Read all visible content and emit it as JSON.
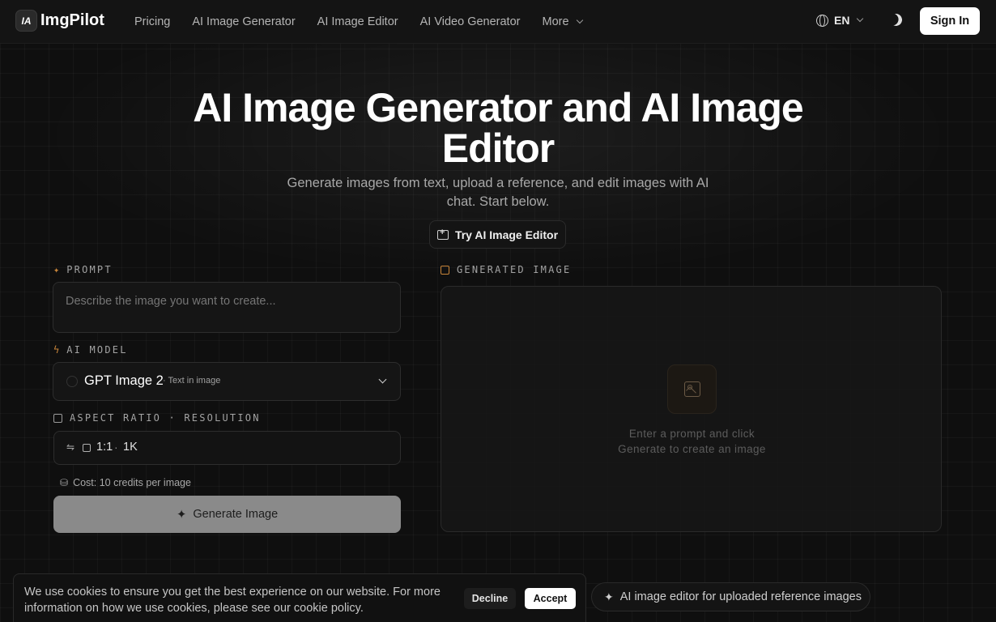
{
  "nav": {
    "logo_mark": "IA",
    "logo_text": "ImgPilot",
    "links": [
      "Pricing",
      "AI Image Generator",
      "AI Image Editor",
      "AI Video Generator"
    ],
    "more_label": "More",
    "language": "EN",
    "sign_in": "Sign In"
  },
  "hero": {
    "title_line1": "AI Image Generator and AI Image",
    "title_line2": "Editor",
    "subtitle": "Generate images from text, upload a reference, and edit images with AI chat. Start below.",
    "cta": "Try AI Image Editor"
  },
  "form": {
    "prompt_label": "PROMPT",
    "prompt_placeholder": "Describe the image you want to create...",
    "model_label": "AI MODEL",
    "model_name": "GPT Image 2",
    "model_tag": "· Text in image",
    "ratio_label": "ASPECT RATIO · RESOLUTION",
    "aspect_ratio": "1:1",
    "separator": "·",
    "resolution": "1K",
    "cost": "Cost: 10 credits per image",
    "generate_label": "Generate Image"
  },
  "output": {
    "label": "GENERATED IMAGE",
    "empty_line1": "Enter a prompt and click",
    "empty_line2": "Generate to create an image"
  },
  "cookie": {
    "text": "We use cookies to ensure you get the best experience on our website. For more information on how we use cookies, please see our cookie policy.",
    "decline": "Decline",
    "accept": "Accept"
  },
  "feature_pill": "AI image editor for uploaded reference images",
  "colors": {
    "accent": "#c8853a",
    "background": "#0f0f0f",
    "button_disabled": "#8a8a8a"
  }
}
